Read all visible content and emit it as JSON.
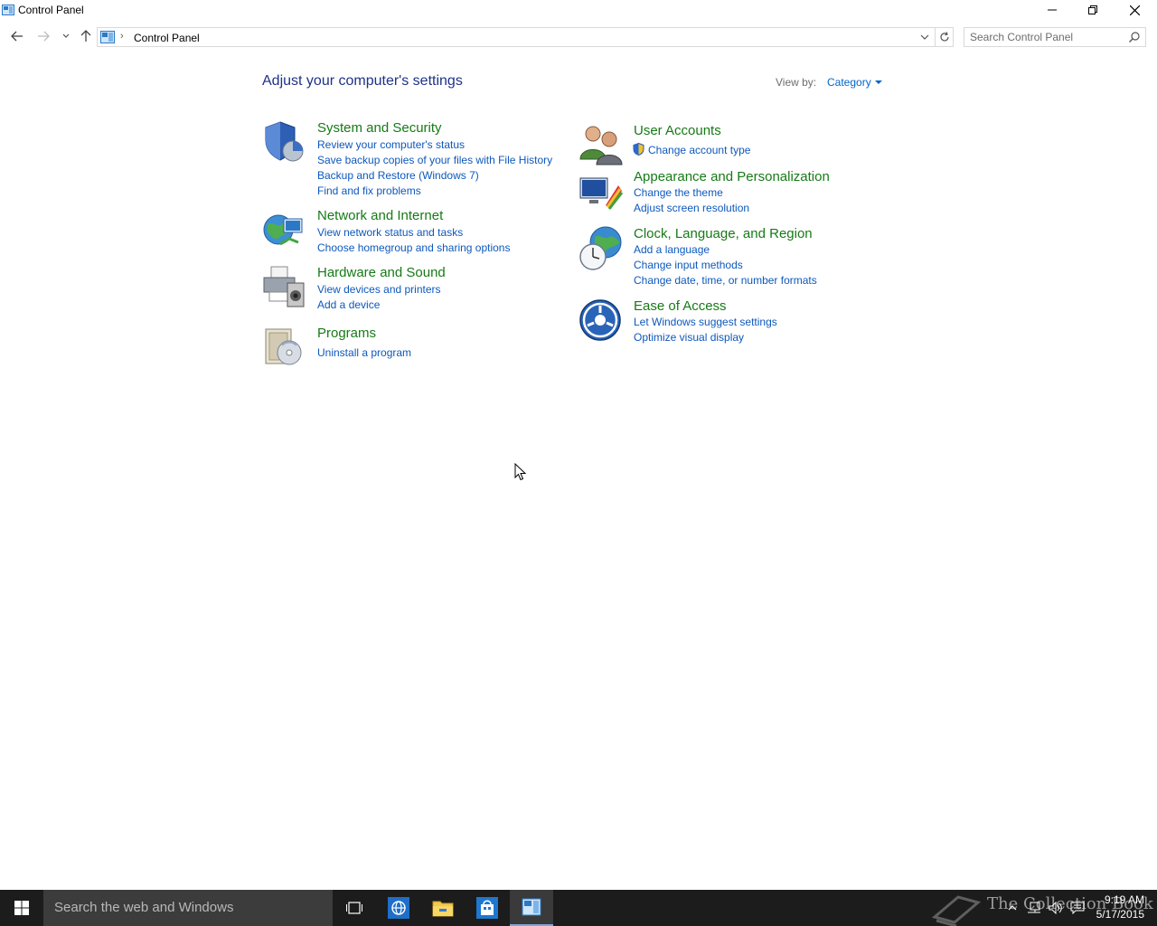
{
  "window": {
    "title": "Control Panel"
  },
  "nav": {
    "breadcrumb": "Control Panel",
    "search_placeholder": "Search Control Panel"
  },
  "main": {
    "heading": "Adjust your computer's settings",
    "view_by_label": "View by:",
    "view_by_value": "Category"
  },
  "categories_left": [
    {
      "title": "System and Security",
      "icon": "shield-icon",
      "links": [
        "Review your computer's status",
        "Save backup copies of your files with File History",
        "Backup and Restore (Windows 7)",
        "Find and fix problems"
      ]
    },
    {
      "title": "Network and Internet",
      "icon": "network-globe-icon",
      "links": [
        "View network status and tasks",
        "Choose homegroup and sharing options"
      ]
    },
    {
      "title": "Hardware and Sound",
      "icon": "printer-speaker-icon",
      "links": [
        "View devices and printers",
        "Add a device"
      ]
    },
    {
      "title": "Programs",
      "icon": "programs-box-icon",
      "links": [
        "Uninstall a program"
      ]
    }
  ],
  "categories_right": [
    {
      "title": "User Accounts",
      "icon": "users-icon",
      "links": [
        "Change account type"
      ]
    },
    {
      "title": "Appearance and Personalization",
      "icon": "monitor-palette-icon",
      "links": [
        "Change the theme",
        "Adjust screen resolution"
      ]
    },
    {
      "title": "Clock, Language, and Region",
      "icon": "clock-globe-icon",
      "links": [
        "Add a language",
        "Change input methods",
        "Change date, time, or number formats"
      ]
    },
    {
      "title": "Ease of Access",
      "icon": "ease-of-access-icon",
      "links": [
        "Let Windows suggest settings",
        "Optimize visual display"
      ]
    }
  ],
  "taskbar": {
    "search_text": "Search the web and Windows",
    "watermark_text": "The Collection Book",
    "time": "9:19 AM",
    "date": "5/17/2015"
  },
  "colors": {
    "heading": "#1e3287",
    "category_title": "#167a16",
    "link": "#0d58bd",
    "taskbar": "#1c1c1c"
  }
}
